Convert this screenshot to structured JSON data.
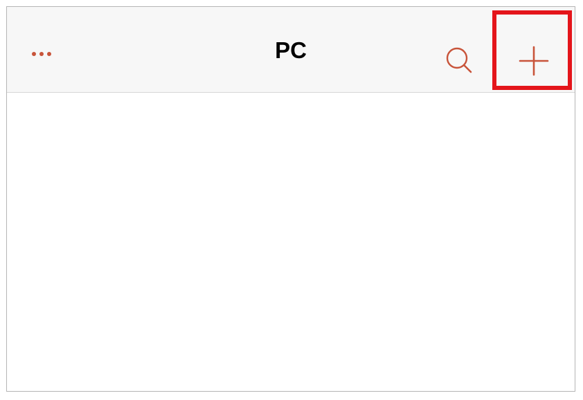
{
  "header": {
    "title": "PC",
    "more_icon": "more-horizontal-icon",
    "search_icon": "search-icon",
    "add_icon": "plus-icon"
  },
  "colors": {
    "accent": "#c8543a",
    "header_bg": "#f7f7f7",
    "highlight": "#e4151b",
    "title_text": "#000000"
  }
}
